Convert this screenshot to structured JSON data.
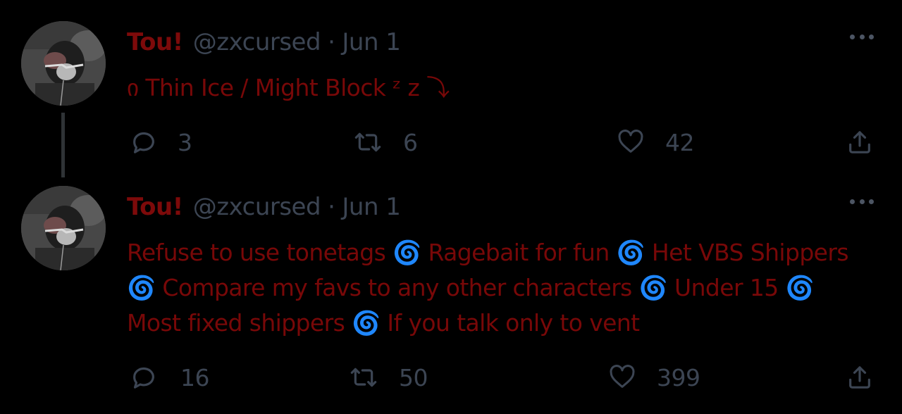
{
  "colors": {
    "background": "#000000",
    "name": "#7d0a0a",
    "text": "#780808",
    "muted": "#3c4553",
    "thread_line": "#2f3336"
  },
  "tweets": [
    {
      "name": "Tou!",
      "handle": "@zxcursed",
      "separator": "·",
      "date": "Jun 1",
      "text": "ი Thin Ice / Might Block ᶻ z ⤵",
      "replies": "3",
      "retweets": "6",
      "likes": "42"
    },
    {
      "name": "Tou!",
      "handle": "@zxcursed",
      "separator": "·",
      "date": "Jun 1",
      "text": "Refuse to use tonetags 🌀 Ragebait for fun 🌀  Het VBS Shippers 🌀 Compare my favs to any other characters 🌀 Under 15 🌀 Most fixed shippers 🌀 If you talk only to vent",
      "replies": "16",
      "retweets": "50",
      "likes": "399"
    }
  ],
  "icons": {
    "reply": "reply-bubble-icon",
    "retweet": "retweet-arrows-icon",
    "like": "heart-icon",
    "share": "share-icon",
    "more": "more-dots-icon"
  }
}
